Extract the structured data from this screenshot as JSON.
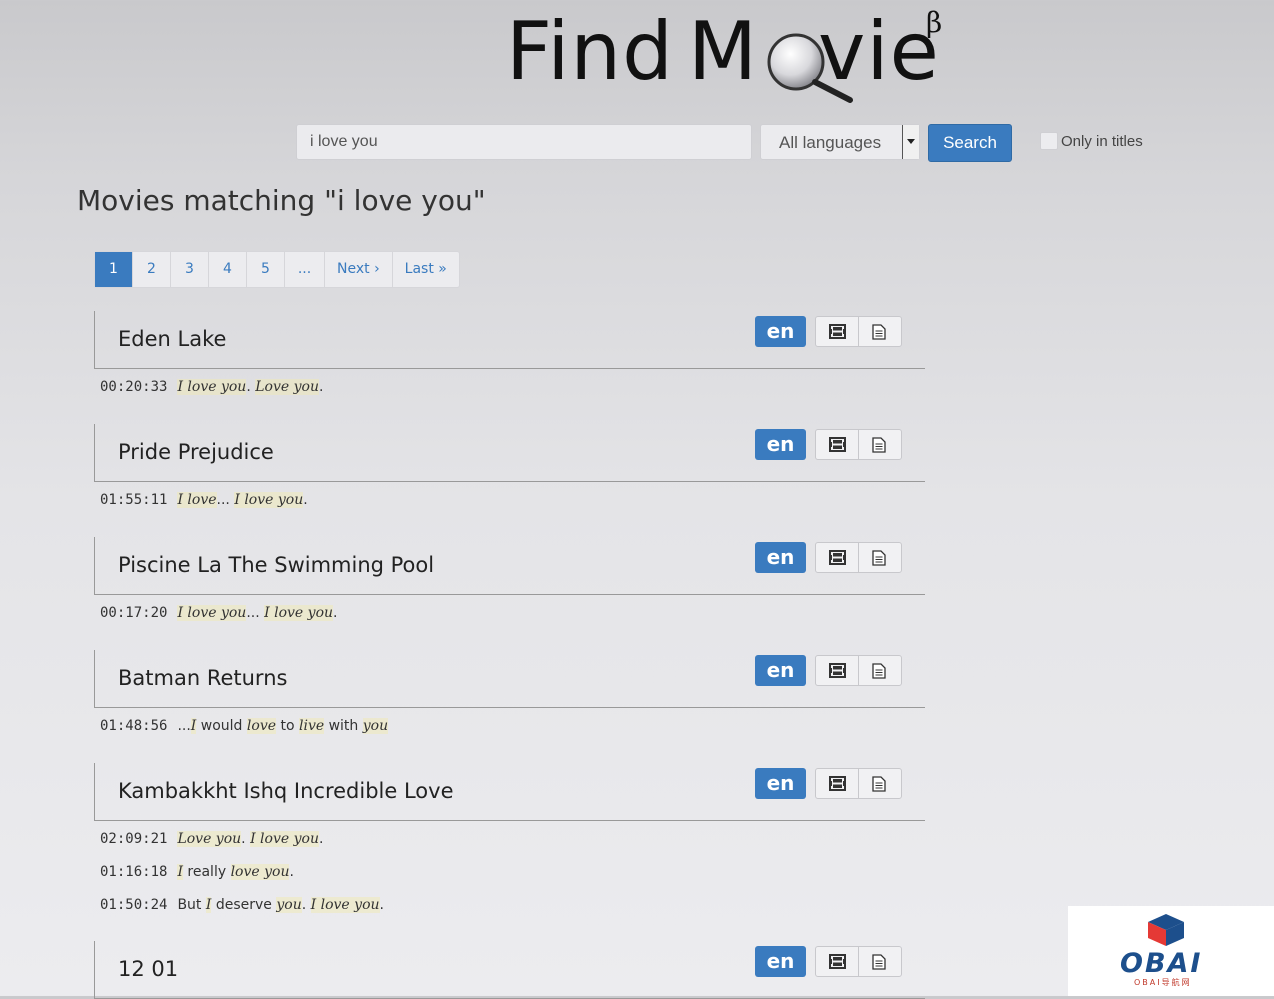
{
  "logo": {
    "find": "Find",
    "m": "M",
    "vie": "vie",
    "beta": "β"
  },
  "search": {
    "query": "i love you",
    "language": "All languages",
    "button_label": "Search",
    "only_titles_label": "Only in titles",
    "only_titles_checked": false
  },
  "heading": "Movies matching \"i love you\"",
  "pagination": {
    "active": "1",
    "pages": [
      "1",
      "2",
      "3",
      "4",
      "5",
      "..."
    ],
    "next": "Next ›",
    "last": "Last »"
  },
  "results": [
    {
      "title": "Eden Lake",
      "lang": "en",
      "quotes": [
        {
          "time": "00:20:33",
          "parts": [
            [
              "I love you",
              1
            ],
            [
              ". ",
              0
            ],
            [
              "Love you",
              1
            ],
            [
              ".",
              0
            ]
          ]
        }
      ]
    },
    {
      "title": "Pride Prejudice",
      "lang": "en",
      "quotes": [
        {
          "time": "01:55:11",
          "parts": [
            [
              "I love",
              1
            ],
            [
              "... ",
              0
            ],
            [
              "I love you",
              1
            ],
            [
              ".",
              0
            ]
          ]
        }
      ]
    },
    {
      "title": "Piscine La The Swimming Pool",
      "lang": "en",
      "quotes": [
        {
          "time": "00:17:20",
          "parts": [
            [
              "I love you",
              1
            ],
            [
              "... ",
              0
            ],
            [
              "I love you",
              1
            ],
            [
              ".",
              0
            ]
          ]
        }
      ]
    },
    {
      "title": "Batman Returns",
      "lang": "en",
      "quotes": [
        {
          "time": "01:48:56",
          "parts": [
            [
              "...",
              0
            ],
            [
              "I",
              1
            ],
            [
              " would ",
              0
            ],
            [
              "love",
              1
            ],
            [
              " to ",
              0
            ],
            [
              "live",
              1
            ],
            [
              " with ",
              0
            ],
            [
              "you",
              1
            ]
          ]
        }
      ]
    },
    {
      "title": "Kambakkht Ishq Incredible Love",
      "lang": "en",
      "quotes": [
        {
          "time": "02:09:21",
          "parts": [
            [
              "Love you",
              1
            ],
            [
              ". ",
              0
            ],
            [
              "I love you",
              1
            ],
            [
              ".",
              0
            ]
          ]
        },
        {
          "time": "01:16:18",
          "parts": [
            [
              "I",
              1
            ],
            [
              " really ",
              0
            ],
            [
              "love you",
              1
            ],
            [
              ".",
              0
            ]
          ]
        },
        {
          "time": "01:50:24",
          "parts": [
            [
              "But ",
              0
            ],
            [
              "I",
              1
            ],
            [
              " deserve ",
              0
            ],
            [
              "you",
              1
            ],
            [
              ". ",
              0
            ],
            [
              "I love you",
              1
            ],
            [
              ".",
              0
            ]
          ]
        }
      ]
    },
    {
      "title": "12 01",
      "lang": "en",
      "quotes": []
    }
  ],
  "icons": {
    "video": "film-icon",
    "subtitles": "document-icon"
  },
  "colors": {
    "accent": "#3a7bbf",
    "highlight": "#f0eab4"
  },
  "watermark": {
    "brand": "OBAI",
    "sub": "OBAI导航网"
  }
}
